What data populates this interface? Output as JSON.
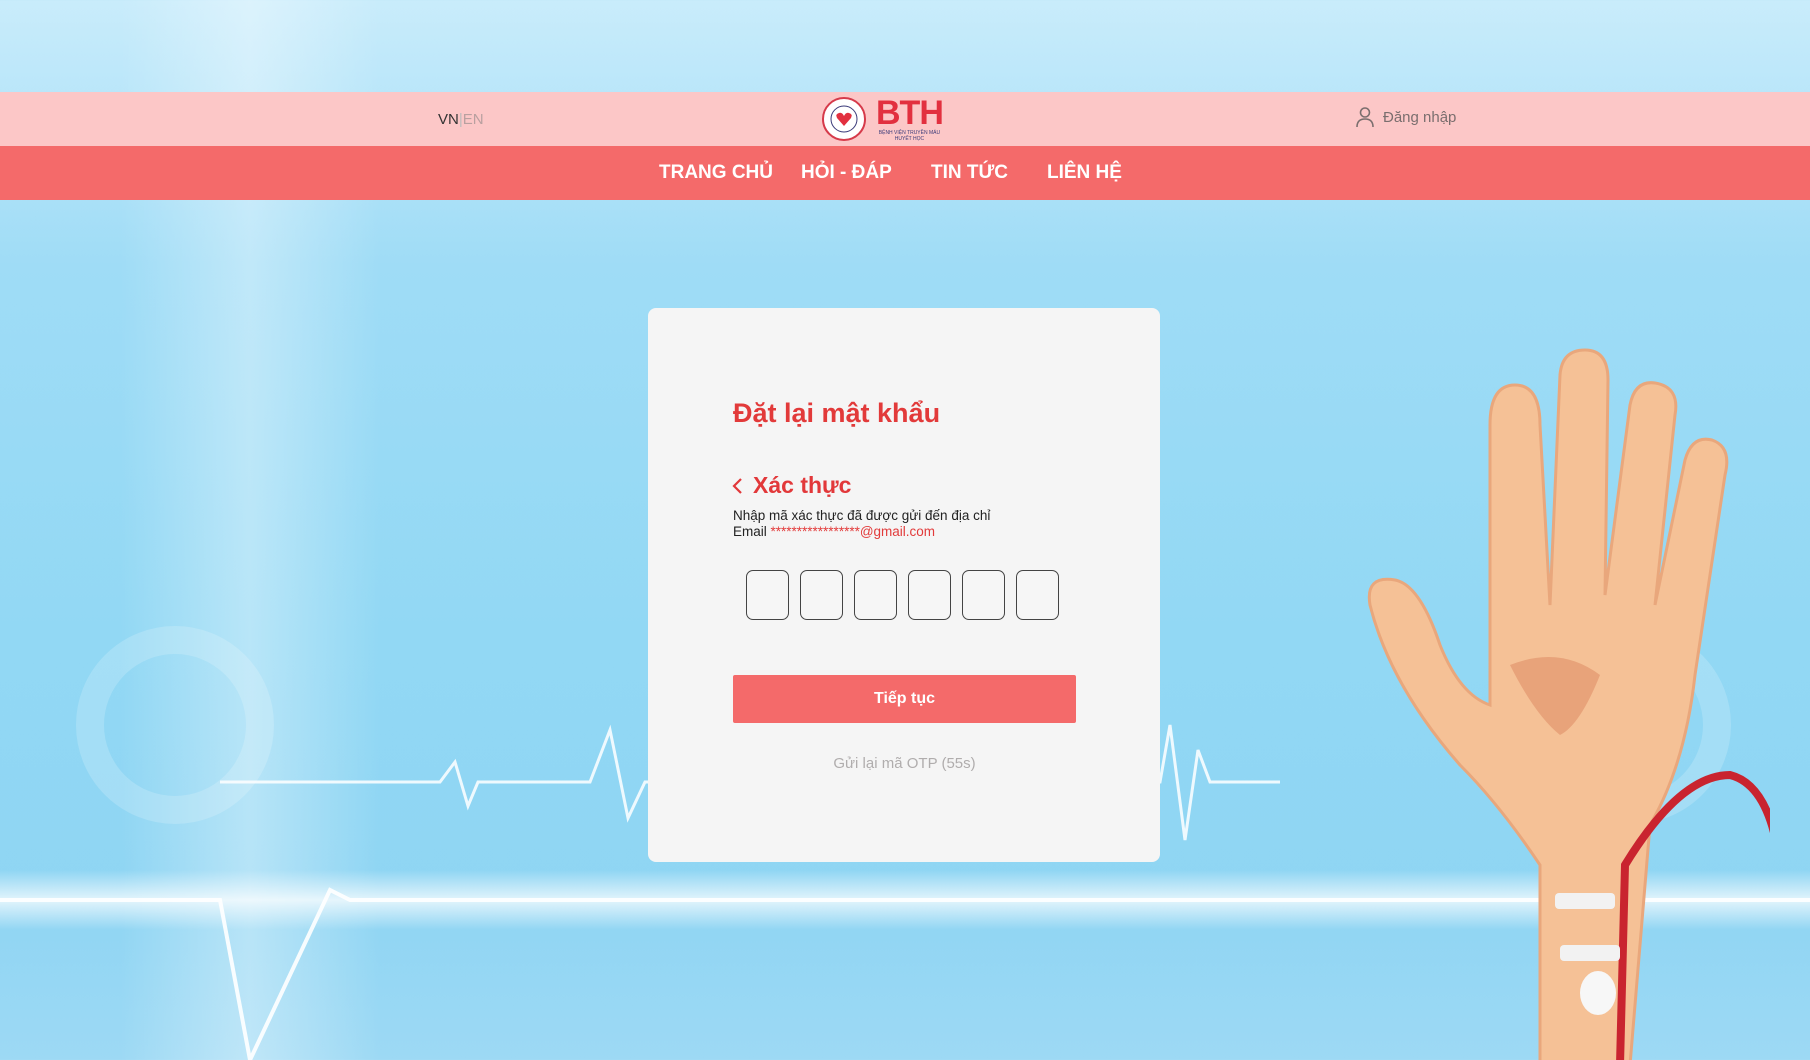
{
  "header": {
    "lang_vn": "VN",
    "lang_sep": "|",
    "lang_en": "EN",
    "logo_letters": "BTH",
    "logo_sub_line1": "BỆNH VIỆN TRUYỀN MÁU",
    "logo_sub_line2": "HUYẾT HỌC",
    "login_label": "Đăng nhập"
  },
  "nav": {
    "items": [
      {
        "label": "TRANG CHỦ"
      },
      {
        "label": "HỎI - ĐÁP"
      },
      {
        "label": "TIN TỨC"
      },
      {
        "label": "LIÊN HỆ"
      }
    ]
  },
  "card": {
    "title": "Đặt lại mật khẩu",
    "back_label": "Xác thực",
    "desc_line1": "Nhập mã xác thực đã được gửi đến địa chỉ",
    "desc_email_prefix": "Email ",
    "desc_email_masked": "*****************@gmail.com",
    "otp_values": [
      "",
      "",
      "",
      "",
      "",
      ""
    ],
    "submit_label": "Tiếp tục",
    "resend_label": "Gửi lại mã OTP (55s)"
  },
  "colors": {
    "accent": "#f46a6a",
    "topbar": "#fcc7c7",
    "title_red": "#e23a3a",
    "background_blue": "#92d8f4"
  }
}
